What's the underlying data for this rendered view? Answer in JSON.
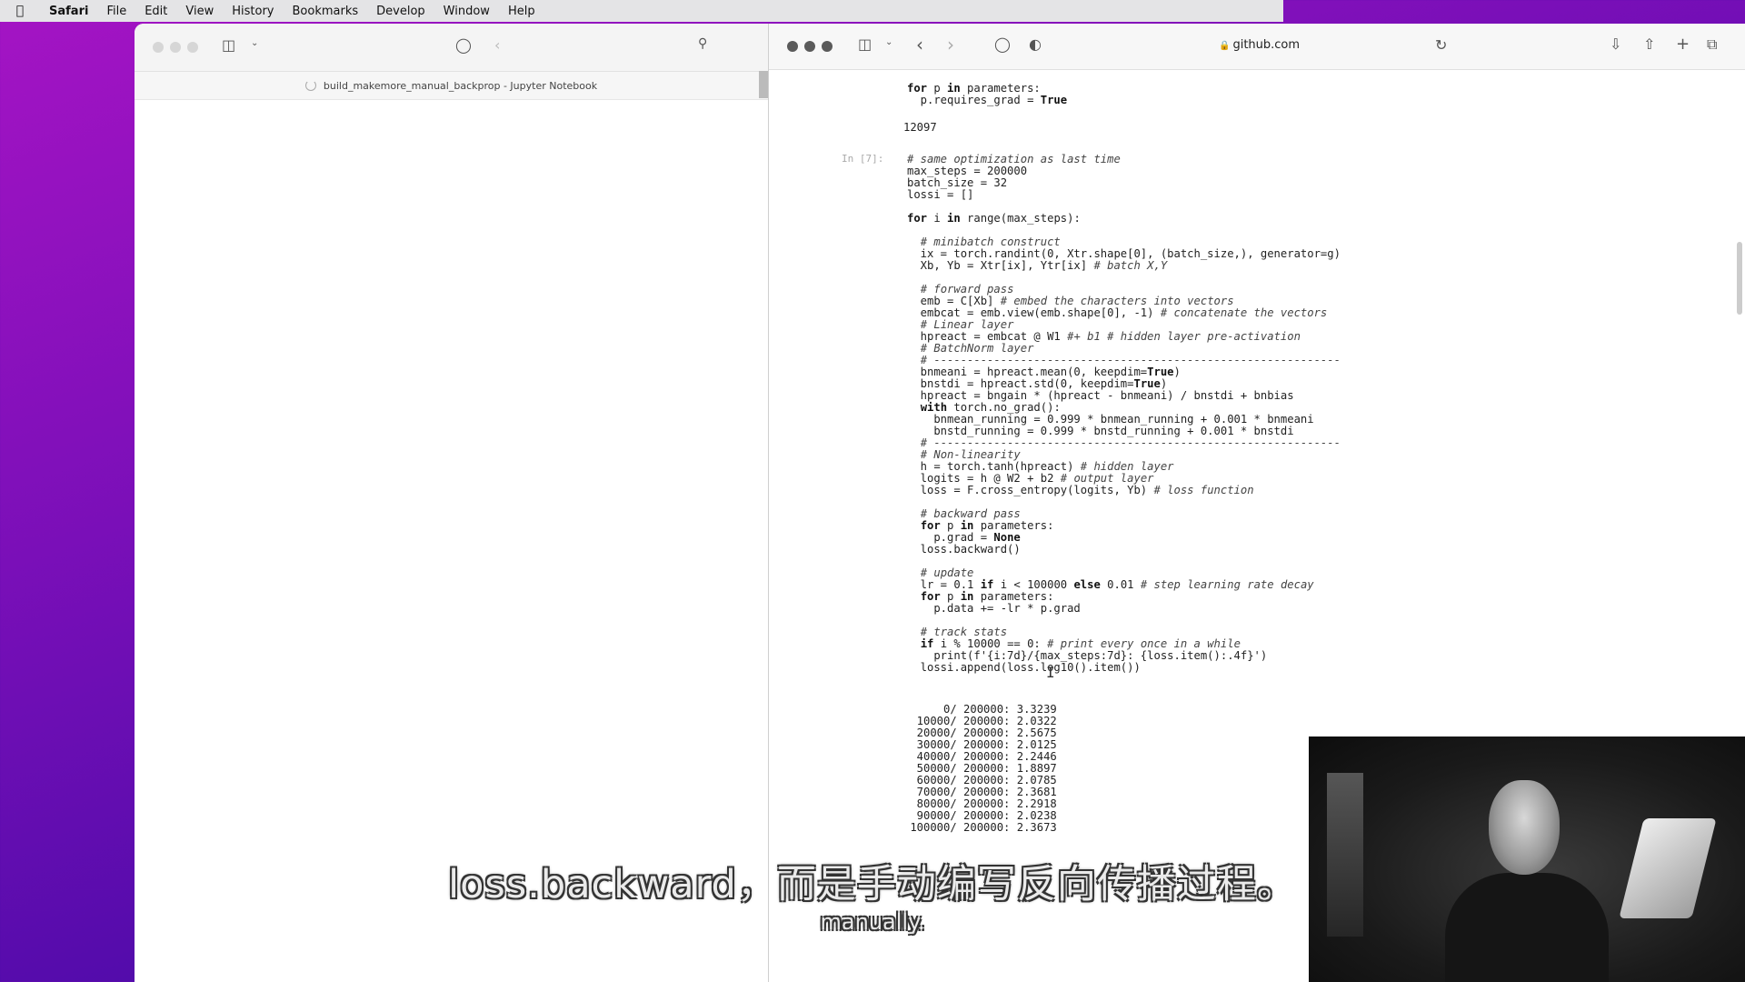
{
  "menubar": {
    "items": [
      "Safari",
      "File",
      "Edit",
      "View",
      "History",
      "Bookmarks",
      "Develop",
      "Window",
      "Help"
    ]
  },
  "left_window": {
    "tab_title": "build_makemore_manual_backprop - Jupyter Notebook"
  },
  "right_window": {
    "url": "github.com"
  },
  "notebook": {
    "cell1_code": [
      "for p in parameters:",
      "  p.requires_grad = True"
    ],
    "cell1_output": "12097",
    "cell2_prompt": "In [7]:",
    "cell2_code": [
      "# same optimization as last time",
      "max_steps = 200000",
      "batch_size = 32",
      "lossi = []",
      "",
      "for i in range(max_steps):",
      "",
      "  # minibatch construct",
      "  ix = torch.randint(0, Xtr.shape[0], (batch_size,), generator=g)",
      "  Xb, Yb = Xtr[ix], Ytr[ix] # batch X,Y",
      "",
      "  # forward pass",
      "  emb = C[Xb] # embed the characters into vectors",
      "  embcat = emb.view(emb.shape[0], -1) # concatenate the vectors",
      "  # Linear layer",
      "  hpreact = embcat @ W1 #+ b1 # hidden layer pre-activation",
      "  # BatchNorm layer",
      "  # -------------------------------------------------------------",
      "  bnmeani = hpreact.mean(0, keepdim=True)",
      "  bnstdi = hpreact.std(0, keepdim=True)",
      "  hpreact = bngain * (hpreact - bnmeani) / bnstdi + bnbias",
      "  with torch.no_grad():",
      "    bnmean_running = 0.999 * bnmean_running + 0.001 * bnmeani",
      "    bnstd_running = 0.999 * bnstd_running + 0.001 * bnstdi",
      "  # -------------------------------------------------------------",
      "  # Non-linearity",
      "  h = torch.tanh(hpreact) # hidden layer",
      "  logits = h @ W2 + b2 # output layer",
      "  loss = F.cross_entropy(logits, Yb) # loss function",
      "",
      "  # backward pass",
      "  for p in parameters:",
      "    p.grad = None",
      "  loss.backward()",
      "",
      "  # update",
      "  lr = 0.1 if i < 100000 else 0.01 # step learning rate decay",
      "  for p in parameters:",
      "    p.data += -lr * p.grad",
      "",
      "  # track stats",
      "  if i % 10000 == 0: # print every once in a while",
      "    print(f'{i:7d}/{max_steps:7d}: {loss.item():.4f}')",
      "  lossi.append(loss.log10().item())"
    ],
    "cell2_output": [
      "      0/ 200000: 3.3239",
      "  10000/ 200000: 2.0322",
      "  20000/ 200000: 2.5675",
      "  30000/ 200000: 2.0125",
      "  40000/ 200000: 2.2446",
      "  50000/ 200000: 1.8897",
      "  60000/ 200000: 2.0785",
      "  70000/ 200000: 2.3681",
      "  80000/ 200000: 2.2918",
      "  90000/ 200000: 2.0238",
      " 100000/ 200000: 2.3673"
    ]
  },
  "subtitles": {
    "zh": "loss.backward，而是手动编写反向传播过程。",
    "en": "manually."
  }
}
